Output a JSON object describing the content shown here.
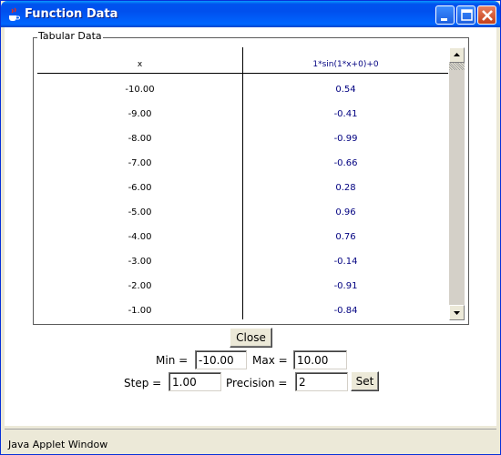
{
  "window": {
    "title": "Function Data",
    "status_text": "Java Applet Window"
  },
  "tabular": {
    "group_label": "Tabular Data",
    "columns": [
      "x",
      "1*sin(1*x+0)+0"
    ],
    "rows": [
      [
        "-10.00",
        "0.54"
      ],
      [
        "-9.00",
        "-0.41"
      ],
      [
        "-8.00",
        "-0.99"
      ],
      [
        "-7.00",
        "-0.66"
      ],
      [
        "-6.00",
        "0.28"
      ],
      [
        "-5.00",
        "0.96"
      ],
      [
        "-4.00",
        "0.76"
      ],
      [
        "-3.00",
        "-0.14"
      ],
      [
        "-2.00",
        "-0.91"
      ],
      [
        "-1.00",
        "-0.84"
      ]
    ],
    "value_color": "#000080"
  },
  "controls": {
    "close_label": "Close",
    "min_label": "Min =",
    "min_value": "-10.00",
    "max_label": "Max =",
    "max_value": "10.00",
    "step_label": "Step =",
    "step_value": "1.00",
    "precision_label": "Precision =",
    "precision_value": "2",
    "set_label": "Set"
  }
}
